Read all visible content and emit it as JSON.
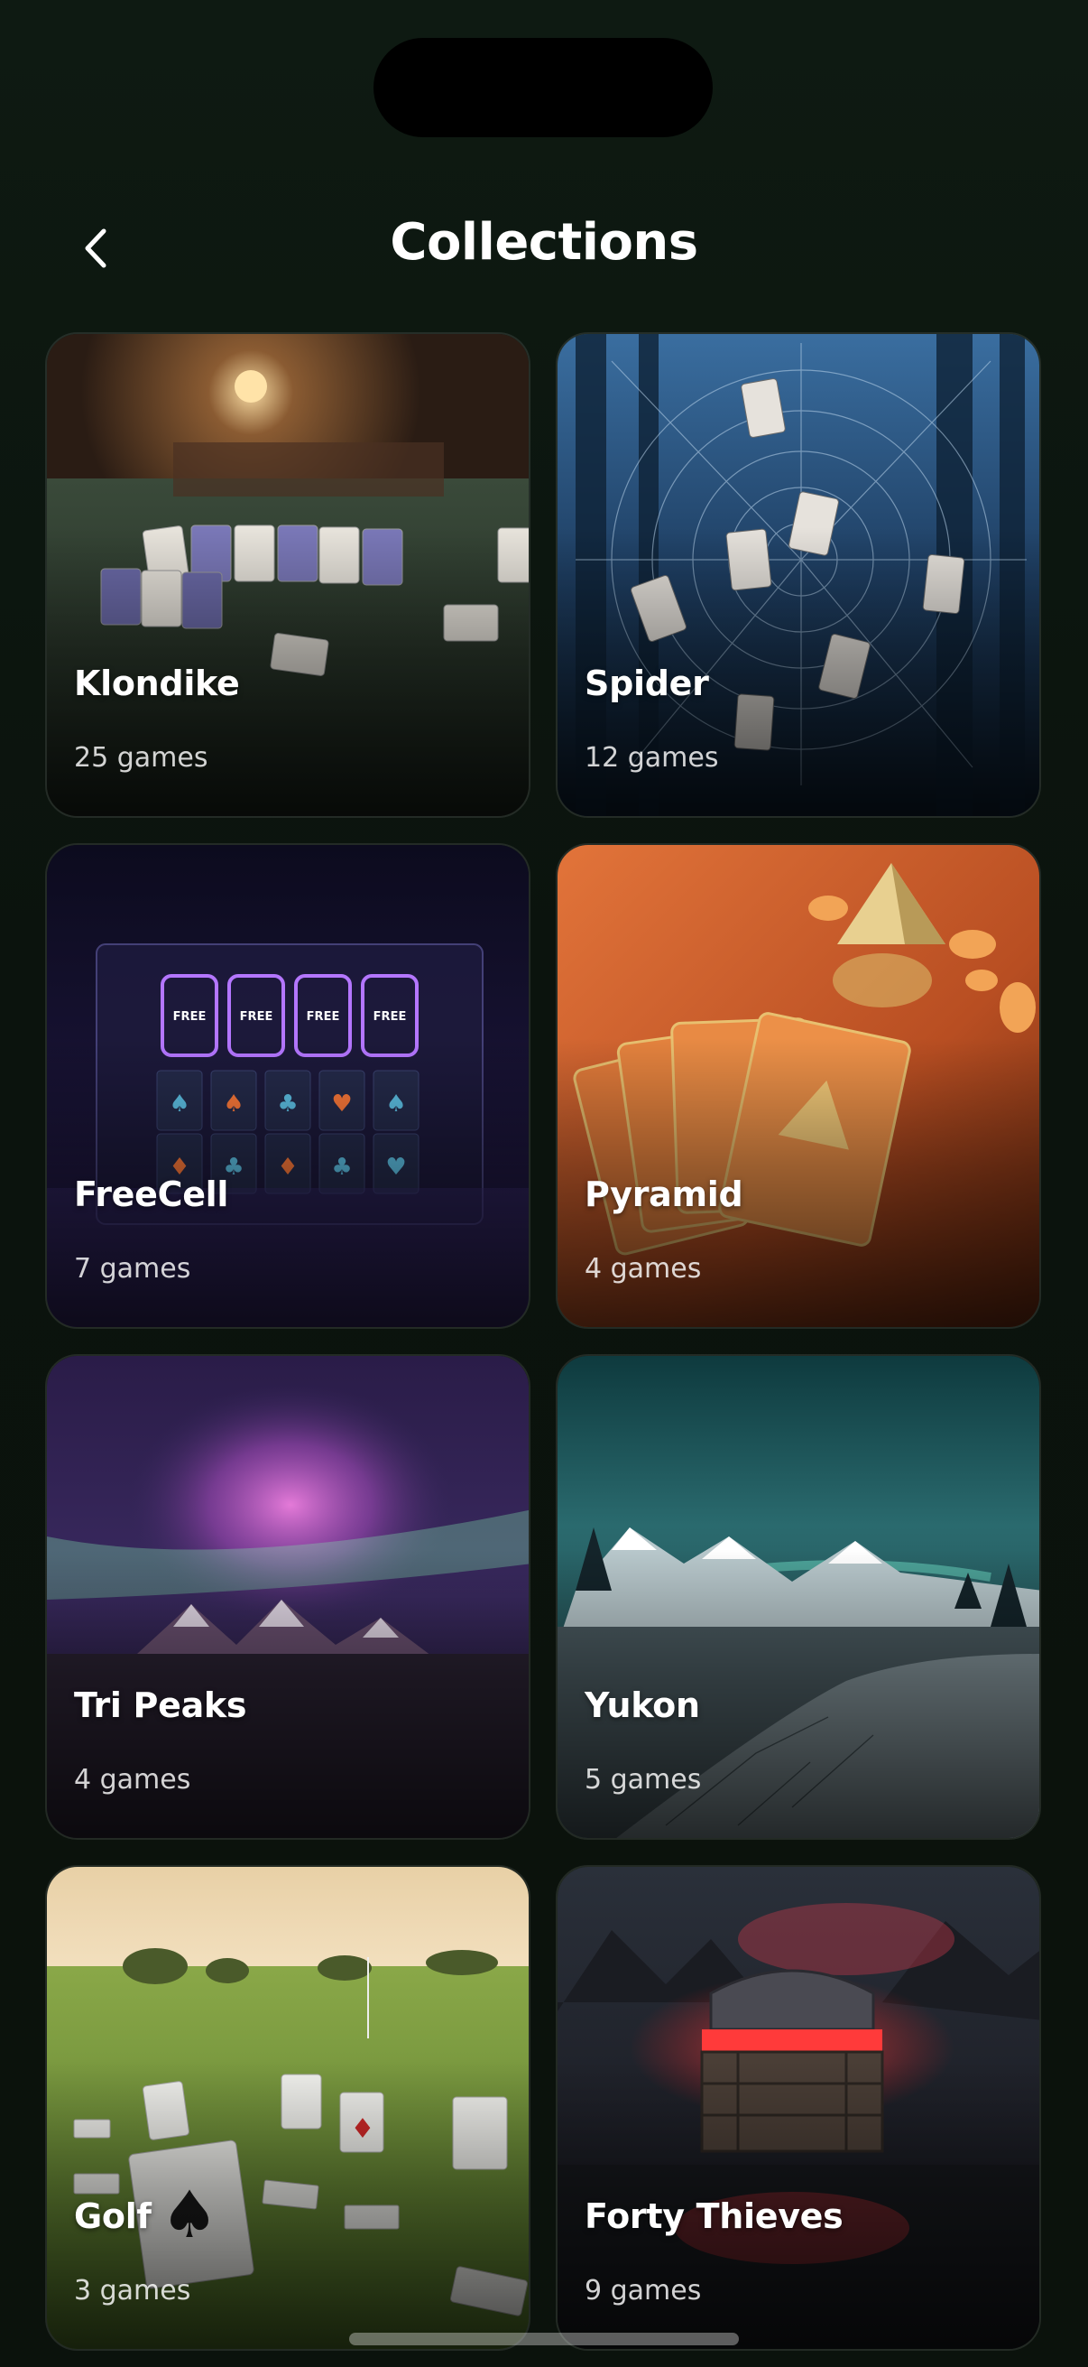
{
  "header": {
    "title": "Collections",
    "back_icon": "chevron-left-icon"
  },
  "collections": [
    {
      "name": "Klondike",
      "count": "25 games",
      "theme": "card-table-wood"
    },
    {
      "name": "Spider",
      "count": "12 games",
      "theme": "spiderweb-forest"
    },
    {
      "name": "FreeCell",
      "count": "7 games",
      "theme": "neon-freecell",
      "cell_label": "FREE"
    },
    {
      "name": "Pyramid",
      "count": "4 games",
      "theme": "golden-pyramid-cards"
    },
    {
      "name": "Tri Peaks",
      "count": "4 games",
      "theme": "aurora-mountains"
    },
    {
      "name": "Yukon",
      "count": "5 games",
      "theme": "frozen-river"
    },
    {
      "name": "Golf",
      "count": "3 games",
      "theme": "golf-course-cards"
    },
    {
      "name": "Forty Thieves",
      "count": "9 games",
      "theme": "treasure-chest"
    }
  ],
  "colors": {
    "background": "#0d1610",
    "title_text": "#ffffff",
    "subtitle_text": "#d0d0d0"
  }
}
